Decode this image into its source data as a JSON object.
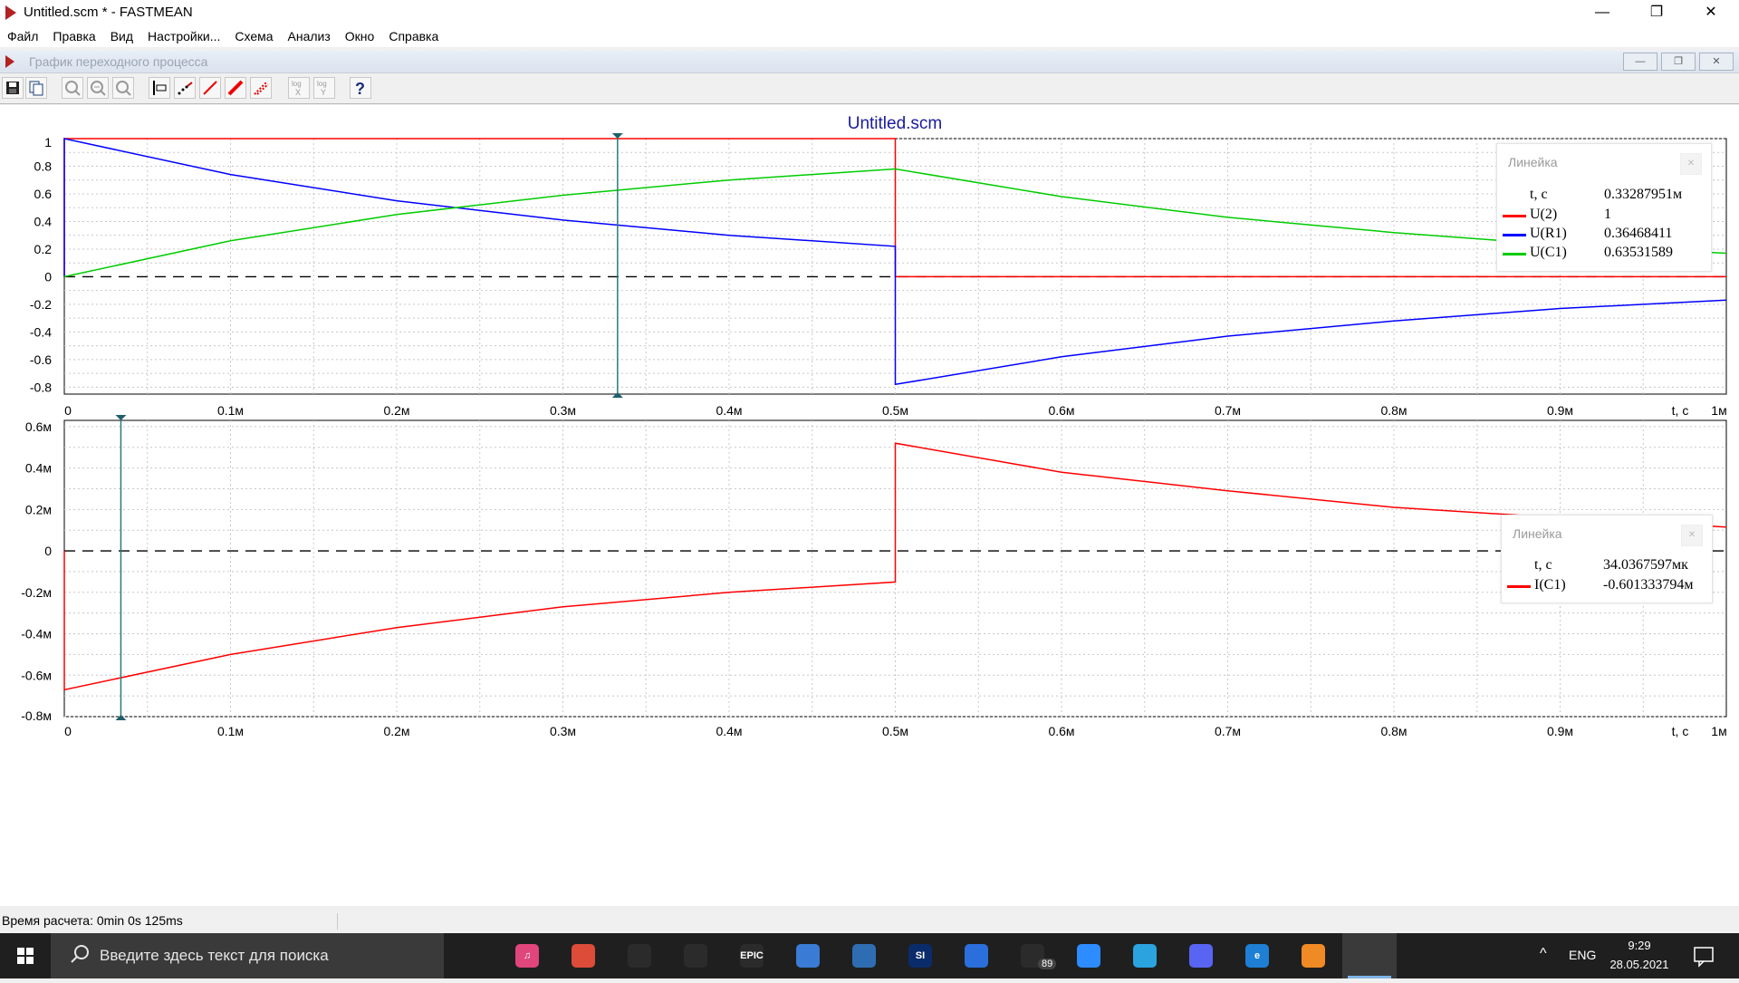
{
  "window": {
    "title": "Untitled.scm * - FASTMEAN",
    "controls": [
      "—",
      "❐",
      "✕"
    ]
  },
  "menu": [
    "Файл",
    "Правка",
    "Вид",
    "Настройки...",
    "Схема",
    "Анализ",
    "Окно",
    "Справка"
  ],
  "child_window": {
    "title": "График переходного процесса",
    "controls": [
      "—",
      "❐",
      "✕"
    ]
  },
  "toolbar": {
    "icons": [
      "save-icon",
      "copy-icon",
      "zoom-icon",
      "zoom-in-icon",
      "zoom-out-icon",
      "marker-icon",
      "points-icon",
      "line-icon",
      "thick-line-icon",
      "grid-line-icon",
      "log-x-icon",
      "log-y-icon",
      "help-icon"
    ],
    "log_label": "log",
    "log_x_label": "X",
    "log_y_label": "Y",
    "help_label": "?"
  },
  "plot": {
    "title": "Untitled.scm",
    "x_axis_label": "t, c",
    "x_ticks": [
      "0",
      "0.1м",
      "0.2м",
      "0.3м",
      "0.4м",
      "0.5м",
      "0.6м",
      "0.7м",
      "0.8м",
      "0.9м",
      "1м"
    ]
  },
  "chart_data": [
    {
      "type": "line",
      "title": "Untitled.scm",
      "xlabel": "t, c",
      "x_unit": "ms",
      "xlim": [
        0,
        1.0
      ],
      "ylim": [
        -0.85,
        1.0
      ],
      "y_ticks": [
        "1",
        "0.8",
        "0.6",
        "0.4",
        "0.2",
        "0",
        "-0.2",
        "-0.4",
        "-0.6",
        "-0.8"
      ],
      "y_tick_values": [
        1,
        0.8,
        0.6,
        0.4,
        0.2,
        0,
        -0.2,
        -0.4,
        -0.6,
        -0.8
      ],
      "grid": true,
      "legend": "top-right",
      "series": [
        {
          "name": "U(2)",
          "color": "#ff0000",
          "x": [
            0,
            0,
            0.5,
            0.5,
            1.0
          ],
          "y": [
            0,
            1,
            1,
            0,
            0
          ]
        },
        {
          "name": "U(R1)",
          "color": "#0000ff",
          "x": [
            0,
            0,
            0.1,
            0.2,
            0.3,
            0.4,
            0.5,
            0.5,
            0.6,
            0.7,
            0.8,
            0.9,
            1.0
          ],
          "y": [
            0,
            1.0,
            0.74,
            0.55,
            0.41,
            0.3,
            0.22,
            -0.78,
            -0.58,
            -0.43,
            -0.32,
            -0.23,
            -0.17
          ]
        },
        {
          "name": "U(C1)",
          "color": "#00cc00",
          "x": [
            0,
            0.1,
            0.2,
            0.3,
            0.4,
            0.5,
            0.6,
            0.7,
            0.8,
            0.9,
            1.0
          ],
          "y": [
            0,
            0.26,
            0.45,
            0.59,
            0.7,
            0.78,
            0.58,
            0.43,
            0.32,
            0.23,
            0.17
          ]
        }
      ],
      "cursor_x": 0.33287951,
      "ruler": {
        "title": "Линейка",
        "t_label": "t, c",
        "t_value": "0.33287951м",
        "rows": [
          {
            "name": "U(2)",
            "value": "1",
            "color": "#ff0000"
          },
          {
            "name": "U(R1)",
            "value": "0.36468411",
            "color": "#0000ff"
          },
          {
            "name": "U(C1)",
            "value": "0.63531589",
            "color": "#00cc00"
          }
        ]
      }
    },
    {
      "type": "line",
      "xlabel": "t, c",
      "x_unit": "ms",
      "xlim": [
        0,
        1.0
      ],
      "ylim": [
        -0.8,
        0.63
      ],
      "y_ticks": [
        "0.6м",
        "0.4м",
        "0.2м",
        "0",
        "-0.2м",
        "-0.4м",
        "-0.6м",
        "-0.8м"
      ],
      "y_tick_values": [
        0.6,
        0.4,
        0.2,
        0,
        -0.2,
        -0.4,
        -0.6,
        -0.8
      ],
      "grid": true,
      "legend": "top-right",
      "series": [
        {
          "name": "I(C1)",
          "color": "#ff0000",
          "x": [
            0,
            0,
            0.1,
            0.2,
            0.3,
            0.4,
            0.5,
            0.5,
            0.6,
            0.7,
            0.8,
            0.9,
            1.0
          ],
          "y": [
            0,
            -0.67,
            -0.5,
            -0.37,
            -0.27,
            -0.2,
            -0.15,
            0.52,
            0.38,
            0.29,
            0.21,
            0.16,
            0.115
          ]
        }
      ],
      "cursor_x": 0.0340367597,
      "ruler": {
        "title": "Линейка",
        "t_label": "t, c",
        "t_value": "34.0367597мк",
        "rows": [
          {
            "name": "I(C1)",
            "value": "-0.601333794м",
            "color": "#ff0000"
          }
        ]
      }
    }
  ],
  "status": {
    "text": "Время расчета: 0min 0s 125ms"
  },
  "taskbar": {
    "search_placeholder": "Введите здесь текст для поиска",
    "apps": [
      {
        "name": "task-view",
        "label": "",
        "color": "#1f1f1f"
      },
      {
        "name": "itunes",
        "label": "♫",
        "color": "#e0457b"
      },
      {
        "name": "chrome",
        "label": "",
        "color": "#dd4b39"
      },
      {
        "name": "xbox",
        "label": "",
        "color": "#2b2b2b"
      },
      {
        "name": "unity",
        "label": "",
        "color": "#2b2b2b"
      },
      {
        "name": "epic-games",
        "label": "EPIC",
        "color": "#2b2b2b"
      },
      {
        "name": "app-blue",
        "label": "",
        "color": "#3a7bd5"
      },
      {
        "name": "app-blue-2",
        "label": "",
        "color": "#2f6db3"
      },
      {
        "name": "si-game",
        "label": "SI",
        "color": "#0b2c6b"
      },
      {
        "name": "app-doc",
        "label": "",
        "color": "#2a6fdb"
      },
      {
        "name": "mail",
        "label": "",
        "color": "#2b2b2b"
      },
      {
        "name": "zoom",
        "label": "",
        "color": "#2d8cff"
      },
      {
        "name": "telegram",
        "label": "",
        "color": "#2aa3df"
      },
      {
        "name": "discord",
        "label": "",
        "color": "#5865f2"
      },
      {
        "name": "edge",
        "label": "e",
        "color": "#1e7fd4"
      },
      {
        "name": "fl-studio",
        "label": "",
        "color": "#f08a24"
      },
      {
        "name": "fastmean",
        "label": "",
        "color": "#3a3a3a"
      }
    ],
    "mail_badge": "89",
    "language": "ENG",
    "time": "9:29",
    "date": "28.05.2021"
  },
  "colors": {
    "u2": "#ff0000",
    "ur1": "#0000ff",
    "uc1": "#00cc00",
    "cursor": "#2a7a7a"
  }
}
